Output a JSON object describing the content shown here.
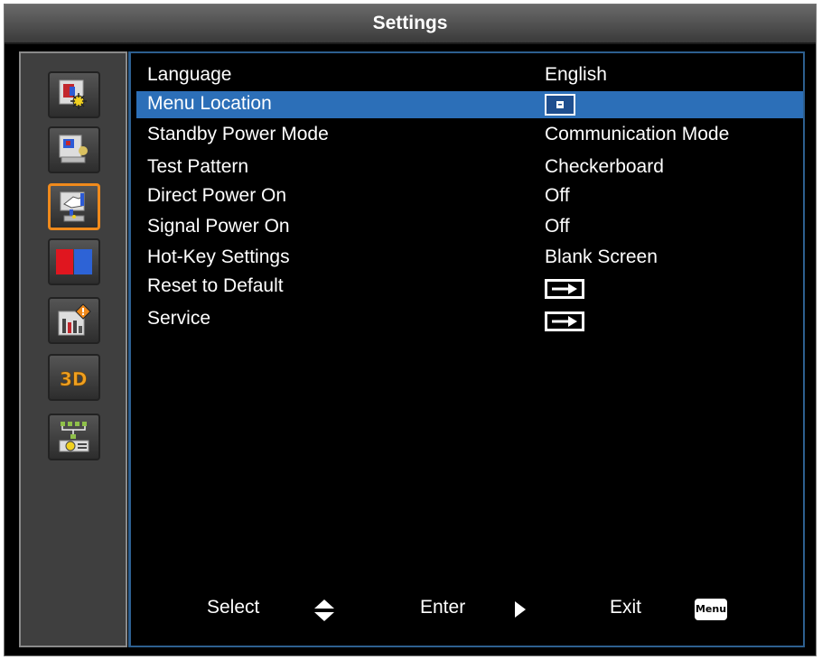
{
  "window": {
    "title": "Settings"
  },
  "sidebar": {
    "items": [
      {
        "icon": "picture-adjust-icon"
      },
      {
        "icon": "display-settings-icon"
      },
      {
        "icon": "setup-hand-icon",
        "active": true
      },
      {
        "icon": "color-blocks-icon"
      },
      {
        "icon": "info-chart-icon"
      },
      {
        "icon": "3d-icon",
        "text": "3D"
      },
      {
        "icon": "network-icon"
      }
    ]
  },
  "menu": {
    "items": [
      {
        "label": "Language",
        "value": "English"
      },
      {
        "label": "Menu Location",
        "value": "",
        "value_icon": "menu-location-center-icon",
        "selected": true
      },
      {
        "label": "Standby Power Mode",
        "value": "Communication Mode"
      },
      {
        "label": "Test Pattern",
        "value": "Checkerboard"
      },
      {
        "label": "Direct Power On",
        "value": "Off"
      },
      {
        "label": "Signal Power On",
        "value": "Off"
      },
      {
        "label": "Hot-Key Settings",
        "value": "Blank Screen"
      },
      {
        "label": "Reset to Default",
        "value": "",
        "value_icon": "enter-arrow-icon"
      },
      {
        "label": "Service",
        "value": "",
        "value_icon": "enter-arrow-icon"
      }
    ]
  },
  "footer": {
    "select_label": "Select",
    "enter_label": "Enter",
    "exit_label": "Exit",
    "menu_key_label": "Menu"
  },
  "colors": {
    "highlight": "#2c6fb8",
    "active_border": "#f08a1c",
    "border": "#2d5f8f"
  }
}
